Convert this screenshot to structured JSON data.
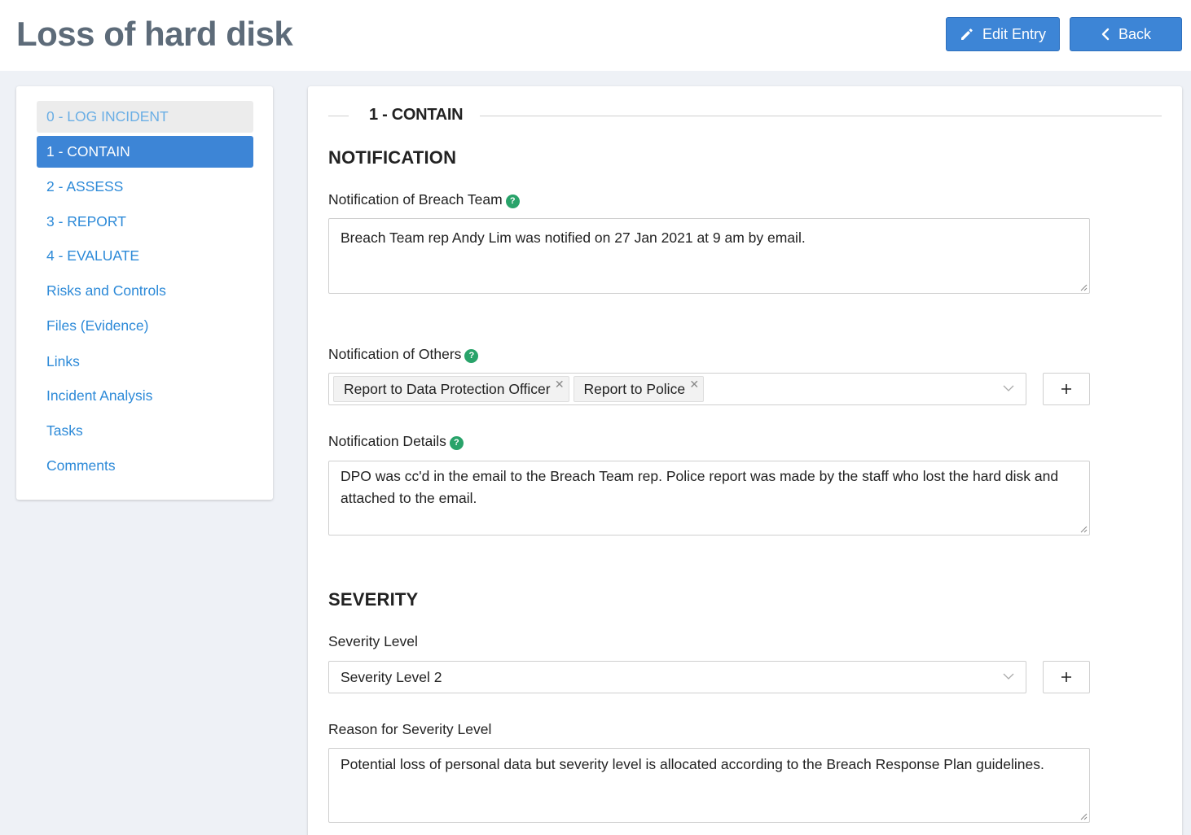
{
  "header": {
    "title": "Loss of hard disk",
    "edit_label": "Edit Entry",
    "back_label": "Back"
  },
  "sidebar": {
    "items": [
      {
        "label": "0 - LOG INCIDENT",
        "state": "disabled"
      },
      {
        "label": "1 - CONTAIN",
        "state": "active"
      },
      {
        "label": "2 - ASSESS",
        "state": "normal"
      },
      {
        "label": "3 - REPORT",
        "state": "normal"
      },
      {
        "label": "4 - EVALUATE",
        "state": "normal"
      },
      {
        "label": "Risks and Controls",
        "state": "normal"
      },
      {
        "label": "Files (Evidence)",
        "state": "normal"
      },
      {
        "label": "Links",
        "state": "normal"
      },
      {
        "label": "Incident Analysis",
        "state": "normal"
      },
      {
        "label": "Tasks",
        "state": "normal"
      },
      {
        "label": "Comments",
        "state": "normal"
      }
    ]
  },
  "main": {
    "section_title": "1 - CONTAIN",
    "notification": {
      "heading": "NOTIFICATION",
      "breach_team_label": "Notification of Breach Team",
      "breach_team_value": "Breach Team rep Andy Lim was notified on 27 Jan 2021 at 9 am by email.",
      "others_label": "Notification of Others",
      "others_chips": [
        "Report to Data Protection Officer",
        "Report to Police"
      ],
      "details_label": "Notification Details",
      "details_value": "DPO was cc'd in the email to the Breach Team rep. Police report was made by the staff who lost the hard disk and attached to the email."
    },
    "severity": {
      "heading": "SEVERITY",
      "level_label": "Severity Level",
      "level_value": "Severity Level 2",
      "reason_label": "Reason for Severity Level",
      "reason_value": "Potential loss of personal data but severity level is allocated according to the Breach Response Plan guidelines."
    }
  },
  "icons": {
    "edit": "pencil-icon",
    "back": "chevron-left-icon",
    "help": "question-icon",
    "remove": "close-icon",
    "dropdown": "chevron-down-icon",
    "add": "plus-icon"
  },
  "colors": {
    "primary": "#3d85d6",
    "link": "#2d8ad8",
    "help": "#29a36a",
    "title": "#5d6b79"
  }
}
